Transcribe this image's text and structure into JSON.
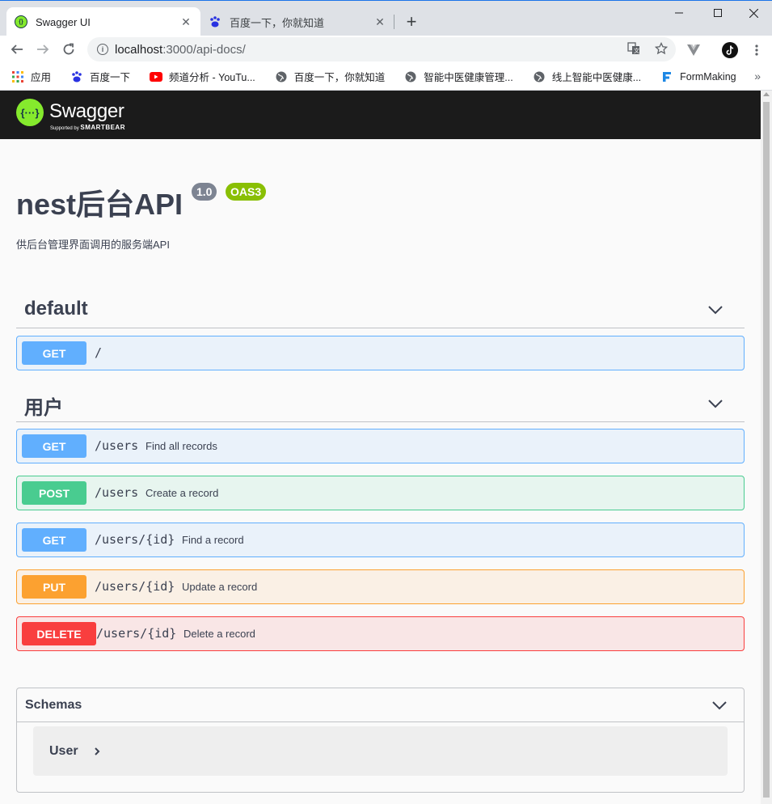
{
  "browser": {
    "tabs": [
      {
        "title": "Swagger UI",
        "icon": "swagger-favicon"
      },
      {
        "title": "百度一下，你就知道",
        "icon": "baidu-paw-icon"
      }
    ],
    "address": {
      "host": "localhost",
      "rest": ":3000/api-docs/"
    },
    "bookmarks": [
      {
        "label": "应用",
        "icon": "apps-grid-icon"
      },
      {
        "label": "百度一下",
        "icon": "baidu-paw-icon"
      },
      {
        "label": "频道分析 - YouTu...",
        "icon": "youtube-icon"
      },
      {
        "label": "百度一下，你就知道",
        "icon": "globe-icon"
      },
      {
        "label": "智能中医健康管理...",
        "icon": "globe-icon"
      },
      {
        "label": "线上智能中医健康...",
        "icon": "globe-icon"
      },
      {
        "label": "FormMaking",
        "icon": "formmaking-icon"
      }
    ]
  },
  "swagger": {
    "logo_text": "Swagger",
    "logo_sub_prefix": "Supported by",
    "logo_sub_brand": "SMARTBEAR",
    "title": "nest后台API",
    "version": "1.0",
    "oas": "OAS3",
    "description": "供后台管理界面调用的服务端API",
    "sections": [
      {
        "name": "default",
        "operations": [
          {
            "method": "GET",
            "path": "/",
            "summary": ""
          }
        ]
      },
      {
        "name": "用户",
        "operations": [
          {
            "method": "GET",
            "path": "/users",
            "summary": "Find all records"
          },
          {
            "method": "POST",
            "path": "/users",
            "summary": "Create a record"
          },
          {
            "method": "GET",
            "path": "/users/{id}",
            "summary": "Find a record"
          },
          {
            "method": "PUT",
            "path": "/users/{id}",
            "summary": "Update a record"
          },
          {
            "method": "DELETE",
            "path": "/users/{id}",
            "summary": "Delete a record"
          }
        ]
      }
    ],
    "schemas": {
      "title": "Schemas",
      "items": [
        "User"
      ]
    }
  },
  "colors": {
    "get": "#61affe",
    "post": "#49cc90",
    "put": "#fca130",
    "delete": "#f93e3e",
    "swagger_green": "#85ea2d",
    "topbar": "#1b1b1b"
  }
}
